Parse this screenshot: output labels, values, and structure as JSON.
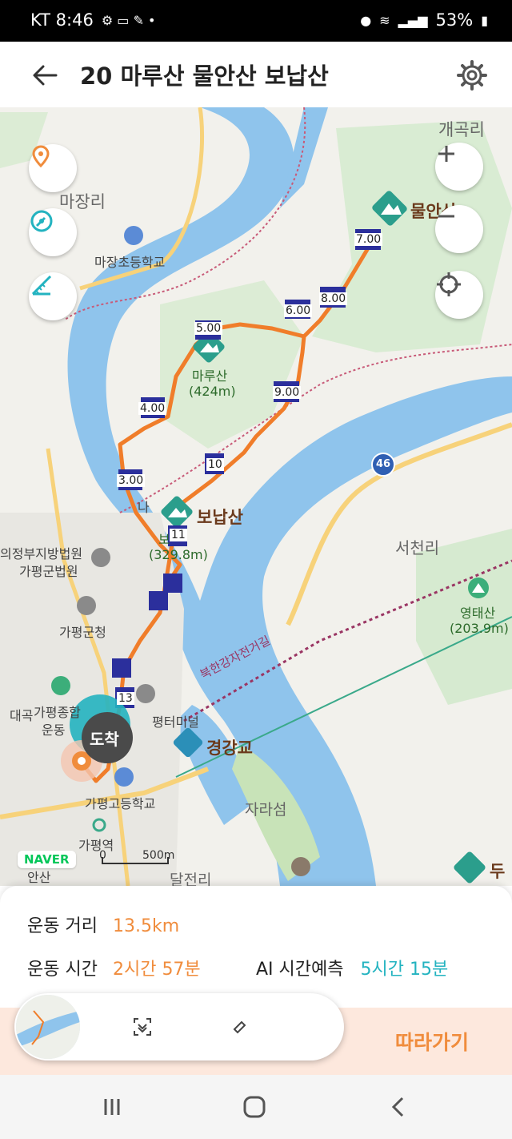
{
  "status_bar": {
    "carrier_time": "KT 8:46",
    "battery": "53%"
  },
  "header": {
    "title": "20 마루산 물안산 보납산"
  },
  "map": {
    "places": {
      "gaegokri": "개곡리",
      "majangri": "마장리",
      "majang_school": "마장초등학교",
      "mulansan": "물안산",
      "marusan": "마루산",
      "marusan_height": "(424m)",
      "bonapsan": "보납산",
      "bonapsan_height": "(329.8m)",
      "bo": "보",
      "seocheonri": "서천리",
      "yeongtaesan": "영태산",
      "yeongtaesan_height": "(203.9m)",
      "court1": "의정부지방법원",
      "court2": "가평군법원",
      "county_office": "가평군청",
      "sports1": "가평종합",
      "sports2": "운동",
      "daegok": "대곡",
      "terminal": "평터미널",
      "bridge": "경강교",
      "bike_road": "북한강자전거길",
      "highschool": "가평고등학교",
      "station": "가평역",
      "jaraseom": "자라섬",
      "daljeonri": "달전리",
      "ansan": "안산",
      "du": "두",
      "na": "나",
      "road_46": "46"
    },
    "waypoints": [
      "3.00",
      "4.00",
      "5.00",
      "6.00",
      "7.00",
      "8.00",
      "9.00",
      "10",
      "11",
      "13"
    ],
    "arrival": "도착",
    "scale_zero": "0",
    "scale_label": "500m",
    "naver": "NAVER",
    "icons": {
      "location": "location-pin-icon",
      "compass": "compass-gauge-icon",
      "measure": "ruler-measure-icon",
      "zoom_in": "plus-icon",
      "zoom_out": "minus-icon",
      "locate": "crosshair-icon"
    },
    "colors": {
      "route": "#f07d2a",
      "waypoint": "#2b2f9c",
      "river": "#8fc4ec",
      "forest": "#d9ecd3",
      "teal": "#23b3c0"
    }
  },
  "stats": {
    "distance_label": "운동 거리",
    "distance_value": "13.5km",
    "time_label": "운동 시간",
    "time_value": "2시간 57분",
    "ai_label": "AI 시간예측",
    "ai_value": "5시간 15분"
  },
  "actions": {
    "follow": "따라가기"
  }
}
